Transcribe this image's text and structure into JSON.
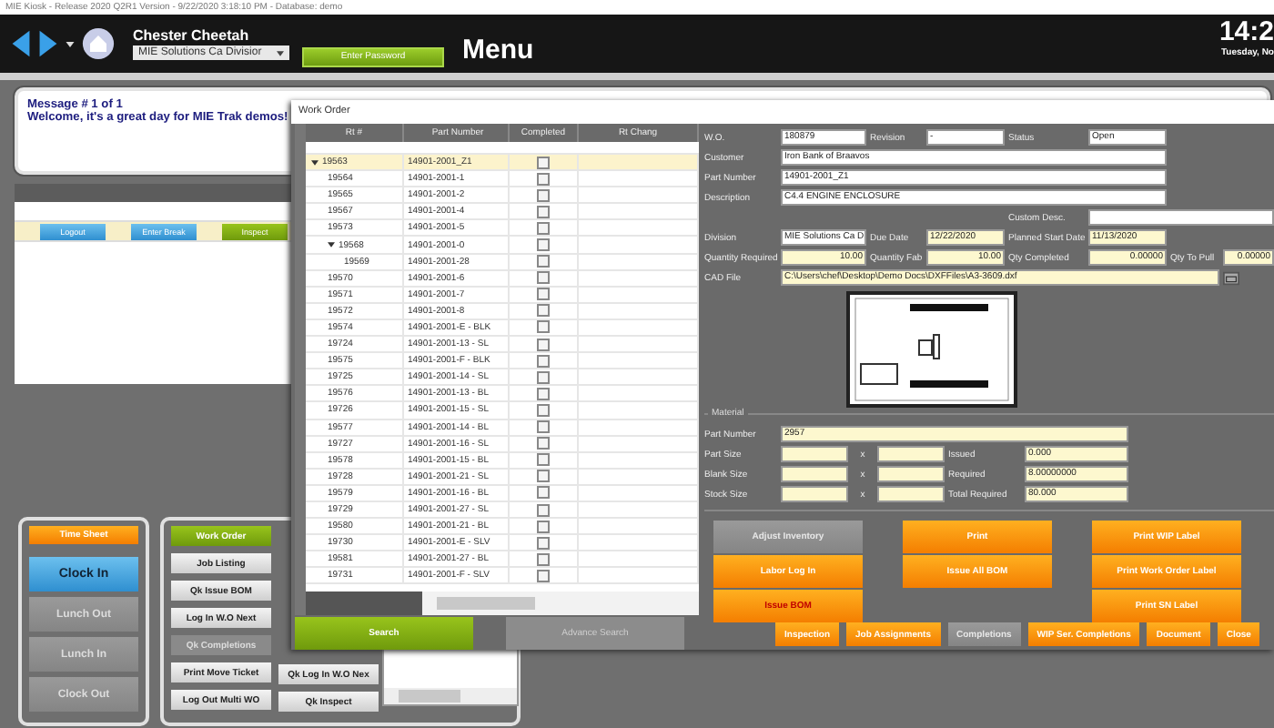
{
  "title_bar": "MIE Kiosk - Release 2020 Q2R1 Version - 9/22/2020 3:18:10 PM - Database: demo",
  "header": {
    "user": "Chester Cheetah",
    "division": "MIE Solutions Ca Divisior",
    "password_button": "Enter Password",
    "page_title": "Menu",
    "clock": "14:2",
    "date": "Tuesday, No"
  },
  "message": {
    "counter": "Message # 1 of 1",
    "text": "Welcome, it's a great day for MIE Trak demos!"
  },
  "activity_buttons": [
    {
      "label": "Logout",
      "kind": "blue"
    },
    {
      "label": "Enter Break",
      "kind": "blue"
    },
    {
      "label": "Inspect",
      "kind": "green"
    }
  ],
  "time_buttons": [
    {
      "label": "Time Sheet",
      "kind": "orange"
    },
    {
      "label": "Clock In",
      "kind": "blue"
    },
    {
      "label": "Lunch Out",
      "kind": "gray"
    },
    {
      "label": "Lunch In",
      "kind": "gray"
    },
    {
      "label": "Clock Out",
      "kind": "gray"
    }
  ],
  "menu_buttons": [
    {
      "label": "Work Order",
      "kind": "green"
    },
    {
      "label": "Job Listing",
      "kind": "light"
    },
    {
      "label": "Qk Issue BOM",
      "kind": "light"
    },
    {
      "label": "Log In W.O Next",
      "kind": "light"
    },
    {
      "label": "Qk Completions",
      "kind": "disabled"
    },
    {
      "label": "Print Move Ticket",
      "kind": "light"
    },
    {
      "label": "Log Out Multi WO",
      "kind": "light"
    }
  ],
  "menu_buttons_2": [
    {
      "label": "Qk Log In W.O Nex",
      "kind": "light"
    },
    {
      "label": "Qk Inspect",
      "kind": "light"
    }
  ],
  "work_order": {
    "title": "Work Order",
    "grid": {
      "columns": [
        "Rt #",
        "Part Number",
        "Completed",
        "Rt Chang"
      ],
      "rows": [
        {
          "rt": "19563",
          "part": "14901-2001_Z1",
          "completed": false,
          "selected": true,
          "expanded": true,
          "children": [
            {
              "rt": "19564",
              "part": "14901-2001-1",
              "completed": false,
              "selected": false
            },
            {
              "rt": "19565",
              "part": "14901-2001-2",
              "completed": false,
              "selected": false
            },
            {
              "rt": "19567",
              "part": "14901-2001-4",
              "completed": false,
              "selected": false
            },
            {
              "rt": "19573",
              "part": "14901-2001-5",
              "completed": false,
              "selected": false
            },
            {
              "rt": "19568",
              "part": "14901-2001-0",
              "completed": false,
              "selected": false,
              "expanded": true,
              "children": [
                {
                  "rt": "19569",
                  "part": "14901-2001-28",
                  "completed": false,
                  "selected": false
                }
              ]
            },
            {
              "rt": "19570",
              "part": "14901-2001-6",
              "completed": false,
              "selected": false
            },
            {
              "rt": "19571",
              "part": "14901-2001-7",
              "completed": false,
              "selected": false
            },
            {
              "rt": "19572",
              "part": "14901-2001-8",
              "completed": false,
              "selected": false
            },
            {
              "rt": "19574",
              "part": "14901-2001-E - BLK",
              "completed": false,
              "selected": false
            },
            {
              "rt": "19724",
              "part": "14901-2001-13 - SL",
              "completed": false,
              "selected": false
            },
            {
              "rt": "19575",
              "part": "14901-2001-F - BLK",
              "completed": false,
              "selected": false
            },
            {
              "rt": "19725",
              "part": "14901-2001-14 - SL",
              "completed": false,
              "selected": false
            },
            {
              "rt": "19576",
              "part": "14901-2001-13 - BL",
              "completed": false,
              "selected": false
            },
            {
              "rt": "19726",
              "part": "14901-2001-15 - SL",
              "completed": false,
              "selected": false
            },
            {
              "rt": "19577",
              "part": "14901-2001-14 - BL",
              "completed": false,
              "selected": false
            },
            {
              "rt": "19727",
              "part": "14901-2001-16 - SL",
              "completed": false,
              "selected": false
            },
            {
              "rt": "19578",
              "part": "14901-2001-15 - BL",
              "completed": false,
              "selected": false
            },
            {
              "rt": "19728",
              "part": "14901-2001-21 - SL",
              "completed": false,
              "selected": false
            },
            {
              "rt": "19579",
              "part": "14901-2001-16 - BL",
              "completed": false,
              "selected": false
            },
            {
              "rt": "19729",
              "part": "14901-2001-27 - SL",
              "completed": false,
              "selected": false
            },
            {
              "rt": "19580",
              "part": "14901-2001-21 - BL",
              "completed": false,
              "selected": false
            },
            {
              "rt": "19730",
              "part": "14901-2001-E - SLV",
              "completed": false,
              "selected": false
            },
            {
              "rt": "19581",
              "part": "14901-2001-27 - BL",
              "completed": false,
              "selected": false
            },
            {
              "rt": "19731",
              "part": "14901-2001-F - SLV",
              "completed": false,
              "selected": false
            }
          ]
        }
      ]
    },
    "search_button": "Search",
    "advance_search_button": "Advance Search",
    "fields": [
      [
        {
          "label": "W.O.",
          "value": "180879",
          "kind": "white"
        },
        {
          "label": "Revision",
          "value": "-",
          "kind": "white"
        },
        {
          "label": "Status",
          "value": "Open",
          "kind": "white"
        }
      ],
      [
        {
          "label": "Customer",
          "value": "Iron Bank of Braavos",
          "kind": "white"
        }
      ],
      [
        {
          "label": "Part Number",
          "value": "14901-2001_Z1",
          "kind": "white"
        }
      ],
      [
        {
          "label": "Description",
          "value": "C4.4 ENGINE ENCLOSURE",
          "kind": "white"
        },
        {
          "label": "Custom Desc.",
          "kind": "white"
        }
      ],
      [
        {
          "label": "Division",
          "value": "MIE Solutions Ca D",
          "kind": "white"
        },
        {
          "label": "Due Date",
          "value": "12/22/2020",
          "kind": "yellow"
        },
        {
          "label": "Planned Start Date",
          "value": "11/13/2020",
          "kind": "yellow"
        }
      ],
      [
        {
          "label": "Quantity Required",
          "value": "10.00",
          "kind": "yellow"
        },
        {
          "label": "Quantity Fab",
          "value": "10.00",
          "kind": "yellow"
        },
        {
          "label": "Qty Completed",
          "value": "0.00000",
          "kind": "yellow"
        },
        {
          "label": "Qty To Pull",
          "value": "0.00000",
          "kind": "yellow"
        }
      ]
    ],
    "cad_file": {
      "label": "CAD File",
      "value": "C:\\Users\\chef\\Desktop\\Demo Docs\\DXFFiles\\A3-3609.dxf"
    },
    "material": {
      "title": "Material",
      "part_label": "Part Number",
      "part_value": "2957",
      "rows": [
        {
          "label": "Part Size",
          "x": "x",
          "result_label": "Issued",
          "result": "0.000"
        },
        {
          "label": "Blank Size",
          "x": "x",
          "result_label": "Required",
          "result": "8.00000000"
        },
        {
          "label": "Stock Size",
          "x": "x",
          "result_label": "Total Required",
          "result": "80.000"
        }
      ]
    },
    "action_columns": [
      [
        {
          "label": "Adjust Inventory",
          "kind": "gray"
        },
        {
          "label": "Labor Log In",
          "kind": "orange"
        },
        {
          "label": "Issue BOM",
          "kind": "alert"
        }
      ],
      [
        {
          "label": "Print",
          "kind": "orange"
        },
        {
          "label": "Issue All BOM",
          "kind": "orange"
        }
      ],
      [
        {
          "label": "Print WIP Label",
          "kind": "orange"
        },
        {
          "label": "Print Work Order Label",
          "kind": "orange"
        },
        {
          "label": "Print SN Label",
          "kind": "orange"
        }
      ]
    ],
    "bottom_buttons": [
      {
        "label": "Inspection",
        "kind": "orange"
      },
      {
        "label": "Job Assignments",
        "kind": "orange"
      },
      {
        "label": "Completions",
        "kind": "gray"
      },
      {
        "label": "WIP Ser. Completions",
        "kind": "orange"
      },
      {
        "label": "Document",
        "kind": "orange"
      },
      {
        "label": "Close",
        "kind": "orange"
      }
    ]
  }
}
